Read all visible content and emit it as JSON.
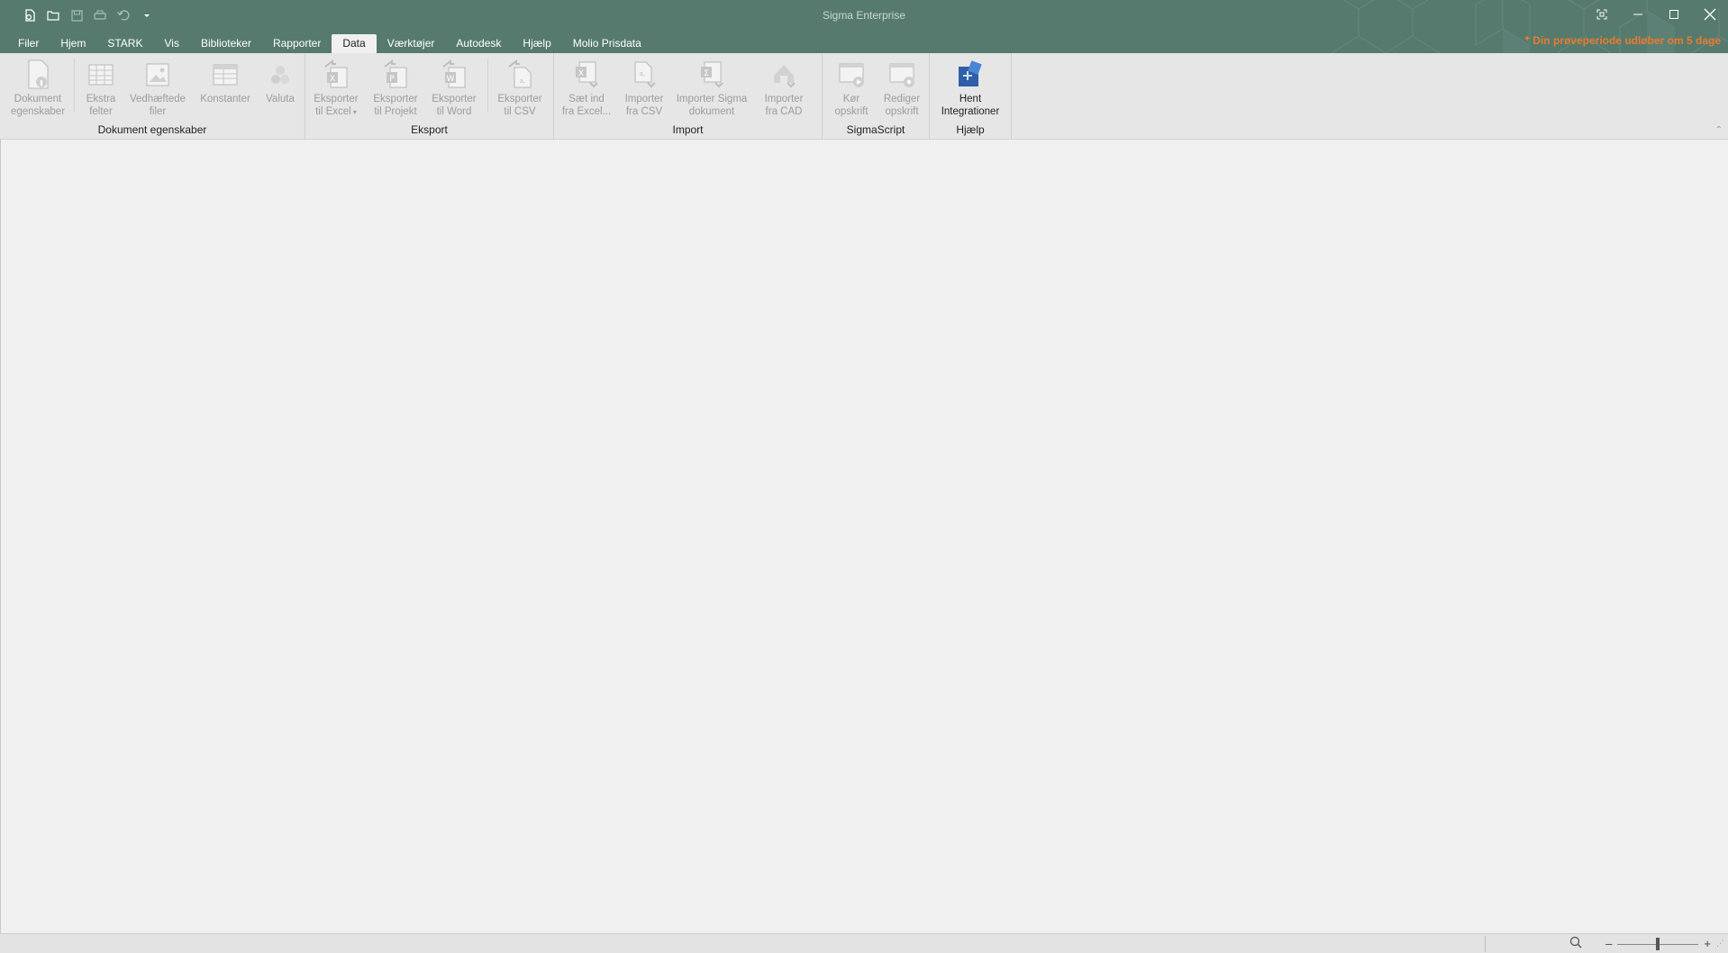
{
  "app": {
    "title": "Sigma Enterprise"
  },
  "qat": {
    "icons": [
      "new-document-icon",
      "open-folder-icon",
      "save-icon",
      "print-icon",
      "undo-icon",
      "qat-dropdown-icon"
    ]
  },
  "tabs": [
    {
      "label": "Filer",
      "active": false
    },
    {
      "label": "Hjem",
      "active": false
    },
    {
      "label": "STARK",
      "active": false
    },
    {
      "label": "Vis",
      "active": false
    },
    {
      "label": "Biblioteker",
      "active": false
    },
    {
      "label": "Rapporter",
      "active": false
    },
    {
      "label": "Data",
      "active": true
    },
    {
      "label": "Værktøjer",
      "active": false
    },
    {
      "label": "Autodesk",
      "active": false
    },
    {
      "label": "Hjælp",
      "active": false
    },
    {
      "label": "Molio Prisdata",
      "active": false
    }
  ],
  "trial_notice": "Din prøveperiode udløber om 5 dage",
  "ribbon": {
    "groups": {
      "dokument": {
        "label": "Dokument egenskaber",
        "buttons": {
          "dokument_egenskaber": {
            "line1": "Dokument",
            "line2": "egenskaber"
          },
          "ekstra_felter": {
            "line1": "Ekstra",
            "line2": "felter"
          },
          "vedhaeftede_filer": {
            "line1": "Vedhæftede",
            "line2": "filer"
          },
          "konstanter": {
            "line1": "Konstanter",
            "line2": ""
          },
          "valuta": {
            "line1": "Valuta",
            "line2": ""
          }
        }
      },
      "eksport": {
        "label": "Eksport",
        "buttons": {
          "excel": {
            "line1": "Eksporter",
            "line2": "til Excel"
          },
          "projekt": {
            "line1": "Eksporter",
            "line2": "til Projekt"
          },
          "word": {
            "line1": "Eksporter",
            "line2": "til Word"
          },
          "csv": {
            "line1": "Eksporter",
            "line2": "til CSV"
          }
        }
      },
      "import": {
        "label": "Import",
        "buttons": {
          "excel": {
            "line1": "Sæt ind",
            "line2": "fra Excel..."
          },
          "csv": {
            "line1": "Importer",
            "line2": "fra CSV"
          },
          "sigma": {
            "line1": "Importer Sigma",
            "line2": "dokument"
          },
          "cad": {
            "line1": "Importer",
            "line2": "fra CAD"
          }
        }
      },
      "sigmascript": {
        "label": "SigmaScript",
        "buttons": {
          "koer": {
            "line1": "Kør",
            "line2": "opskrift"
          },
          "rediger": {
            "line1": "Rediger",
            "line2": "opskrift"
          }
        }
      },
      "hjaelp": {
        "label": "Hjælp",
        "buttons": {
          "hent": {
            "line1": "Hent",
            "line2": "Integrationer"
          }
        }
      }
    }
  },
  "colors": {
    "titlebar": "#567a6e",
    "trial": "#e87d2f",
    "ribbon": "#e6e6e6",
    "disabled_text": "#9c9c9c",
    "integration_icon": "#2f5fa8"
  }
}
